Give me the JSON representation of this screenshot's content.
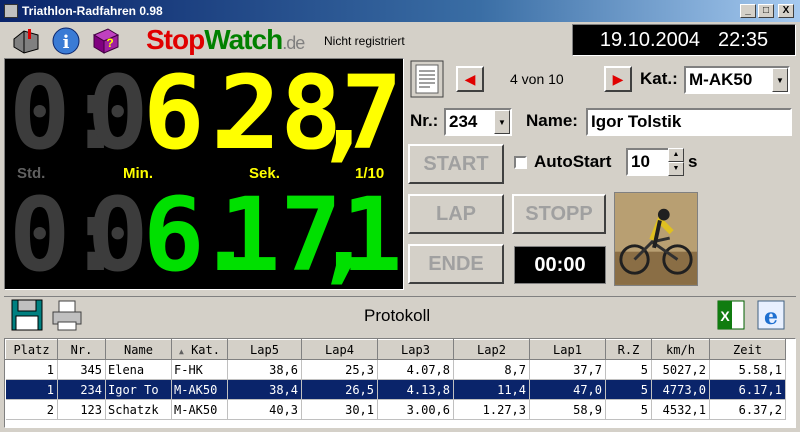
{
  "window": {
    "title": "Triathlon-Radfahren 0.98",
    "minimize": "_",
    "maximize": "□",
    "close": "X"
  },
  "header": {
    "logo_stop": "Stop",
    "logo_watch": "Watch",
    "logo_de": ".de",
    "registration_status": "Nicht registriert",
    "date": "19.10.2004",
    "time": "22:35"
  },
  "display": {
    "row1": {
      "hours": "0",
      "colon": ":",
      "min_tens": "0",
      "min_ones": "6",
      "dot": ".",
      "sec": "28",
      "comma": ",",
      "tenth": "7"
    },
    "row2": {
      "hours": "0",
      "colon": ":",
      "min_tens": "0",
      "min_ones": "6",
      "dot": ".",
      "sec": "17",
      "comma": ",",
      "tenth": "1"
    },
    "labels": {
      "std": "Std.",
      "min": "Min.",
      "sek": "Sek.",
      "tenth": "1/10"
    }
  },
  "controls": {
    "counter": "4 von 10",
    "kat_label": "Kat.:",
    "kat_value": "M-AK50",
    "nr_label": "Nr.:",
    "nr_value": "234",
    "name_label": "Name:",
    "name_value": "Igor Tolstik",
    "start": "START",
    "autostart_label": "AutoStart",
    "autostart_value": "10",
    "autostart_unit": "s",
    "lap": "LAP",
    "stopp": "STOPP",
    "ende": "ENDE",
    "timer": "00:00"
  },
  "protokoll": {
    "title": "Protokoll",
    "columns": [
      "Platz",
      "Nr.",
      "Name",
      "Kat.",
      "Lap5",
      "Lap4",
      "Lap3",
      "Lap2",
      "Lap1",
      "R.Z",
      "km/h",
      "Zeit"
    ],
    "sort_indicator": "▲",
    "rows": [
      [
        "1",
        "345",
        "Elena",
        "F-HK",
        "38,6",
        "25,3",
        "4.07,8",
        "8,7",
        "37,7",
        "5",
        "5027,2",
        "5.58,1"
      ],
      [
        "1",
        "234",
        "Igor To",
        "M-AK50",
        "38,4",
        "26,5",
        "4.13,8",
        "11,4",
        "47,0",
        "5",
        "4773,0",
        "6.17,1"
      ],
      [
        "2",
        "123",
        "Schatzk",
        "M-AK50",
        "40,3",
        "30,1",
        "3.00,6",
        "1.27,3",
        "58,9",
        "5",
        "4532,1",
        "6.37,2"
      ]
    ],
    "selected_row": 1
  }
}
